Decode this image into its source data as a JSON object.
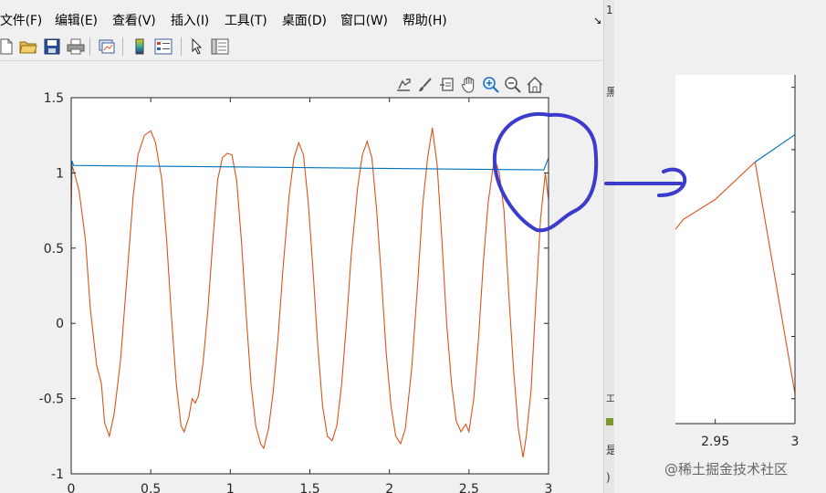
{
  "menu": {
    "items": [
      "文件(F)",
      "编辑(E)",
      "查看(V)",
      "插入(I)",
      "工具(T)",
      "桌面(D)",
      "窗口(W)",
      "帮助(H)"
    ],
    "corner_glyph": "↘"
  },
  "toolbar": {
    "icons": [
      "new-file-icon",
      "open-folder-icon",
      "save-icon",
      "print-icon",
      "link-plot-icon",
      "colorbar-icon",
      "legend-icon",
      "edit-plot-arrow-icon",
      "property-inspector-icon"
    ]
  },
  "axes_toolbar": {
    "icons": [
      "export-icon",
      "brush-icon",
      "datatip-icon",
      "pan-hand-icon",
      "zoom-in-icon",
      "zoom-out-icon",
      "home-icon"
    ]
  },
  "colors": {
    "series_orange": "#d95319",
    "series_blue": "#0072bd",
    "annotation_blue": "#3b3bcc",
    "axes_text": "#262626"
  },
  "chart_data": [
    {
      "type": "line",
      "title": "",
      "xlabel": "",
      "ylabel": "",
      "xlim": [
        0,
        3
      ],
      "ylim": [
        -1,
        1.5
      ],
      "x_ticks": [
        "0",
        "0.5",
        "1",
        "1.5",
        "2",
        "2.5",
        "3"
      ],
      "y_ticks": [
        "-1",
        "-0.5",
        "0",
        "0.5",
        "1",
        "1.5"
      ],
      "grid": false,
      "series": [
        {
          "color": "orange",
          "points": [
            [
              0.0,
              0.74
            ],
            [
              0.005,
              1.05
            ],
            [
              0.02,
              1.0
            ],
            [
              0.05,
              0.88
            ],
            [
              0.09,
              0.55
            ],
            [
              0.12,
              0.1
            ],
            [
              0.16,
              -0.28
            ],
            [
              0.19,
              -0.4
            ],
            [
              0.21,
              -0.66
            ],
            [
              0.24,
              -0.75
            ],
            [
              0.27,
              -0.6
            ],
            [
              0.31,
              -0.25
            ],
            [
              0.35,
              0.3
            ],
            [
              0.39,
              0.85
            ],
            [
              0.42,
              1.12
            ],
            [
              0.46,
              1.25
            ],
            [
              0.5,
              1.28
            ],
            [
              0.53,
              1.2
            ],
            [
              0.57,
              0.95
            ],
            [
              0.6,
              0.55
            ],
            [
              0.63,
              0.05
            ],
            [
              0.66,
              -0.4
            ],
            [
              0.69,
              -0.68
            ],
            [
              0.71,
              -0.72
            ],
            [
              0.74,
              -0.62
            ],
            [
              0.76,
              -0.5
            ],
            [
              0.78,
              -0.53
            ],
            [
              0.8,
              -0.48
            ],
            [
              0.83,
              -0.25
            ],
            [
              0.86,
              0.1
            ],
            [
              0.89,
              0.55
            ],
            [
              0.92,
              0.95
            ],
            [
              0.95,
              1.1
            ],
            [
              0.98,
              1.13
            ],
            [
              1.01,
              1.12
            ],
            [
              1.04,
              0.95
            ],
            [
              1.07,
              0.55
            ],
            [
              1.1,
              0.05
            ],
            [
              1.13,
              -0.4
            ],
            [
              1.16,
              -0.68
            ],
            [
              1.19,
              -0.8
            ],
            [
              1.21,
              -0.83
            ],
            [
              1.24,
              -0.7
            ],
            [
              1.27,
              -0.45
            ],
            [
              1.3,
              -0.1
            ],
            [
              1.33,
              0.35
            ],
            [
              1.37,
              0.85
            ],
            [
              1.4,
              1.1
            ],
            [
              1.43,
              1.2
            ],
            [
              1.46,
              1.12
            ],
            [
              1.49,
              0.8
            ],
            [
              1.52,
              0.35
            ],
            [
              1.55,
              -0.15
            ],
            [
              1.58,
              -0.55
            ],
            [
              1.61,
              -0.75
            ],
            [
              1.64,
              -0.78
            ],
            [
              1.67,
              -0.68
            ],
            [
              1.7,
              -0.4
            ],
            [
              1.73,
              0.0
            ],
            [
              1.76,
              0.45
            ],
            [
              1.8,
              0.9
            ],
            [
              1.83,
              1.12
            ],
            [
              1.86,
              1.21
            ],
            [
              1.89,
              1.1
            ],
            [
              1.92,
              0.75
            ],
            [
              1.95,
              0.3
            ],
            [
              1.98,
              -0.2
            ],
            [
              2.01,
              -0.55
            ],
            [
              2.04,
              -0.75
            ],
            [
              2.07,
              -0.8
            ],
            [
              2.1,
              -0.7
            ],
            [
              2.14,
              -0.3
            ],
            [
              2.18,
              0.3
            ],
            [
              2.21,
              0.8
            ],
            [
              2.24,
              1.1
            ],
            [
              2.27,
              1.3
            ],
            [
              2.3,
              1.05
            ],
            [
              2.33,
              0.55
            ],
            [
              2.36,
              0.0
            ],
            [
              2.39,
              -0.4
            ],
            [
              2.42,
              -0.65
            ],
            [
              2.45,
              -0.72
            ],
            [
              2.48,
              -0.67
            ],
            [
              2.5,
              -0.72
            ],
            [
              2.53,
              -0.5
            ],
            [
              2.56,
              -0.1
            ],
            [
              2.59,
              0.4
            ],
            [
              2.62,
              0.8
            ],
            [
              2.64,
              0.95
            ],
            [
              2.66,
              1.1
            ],
            [
              2.69,
              1.0
            ],
            [
              2.72,
              0.75
            ],
            [
              2.75,
              0.2
            ],
            [
              2.78,
              -0.3
            ],
            [
              2.81,
              -0.7
            ],
            [
              2.84,
              -0.89
            ],
            [
              2.86,
              -0.75
            ],
            [
              2.89,
              -0.45
            ],
            [
              2.92,
              0.15
            ],
            [
              2.95,
              0.7
            ],
            [
              2.98,
              1.0
            ],
            [
              3.0,
              0.82
            ]
          ]
        },
        {
          "color": "blue",
          "points": [
            [
              0.0,
              0.9
            ],
            [
              0.005,
              1.08
            ],
            [
              0.015,
              1.05
            ],
            [
              2.97,
              1.02
            ],
            [
              3.0,
              1.1
            ]
          ]
        }
      ]
    },
    {
      "type": "line",
      "title": "",
      "xlabel": "",
      "ylabel": "",
      "xlim": [
        2.925,
        3
      ],
      "x_ticks": [
        "2.95",
        "3"
      ],
      "y_ticks": [],
      "grid": false,
      "series": [
        {
          "color": "orange",
          "points": [
            [
              2.925,
              0.68
            ],
            [
              2.93,
              0.72
            ],
            [
              2.95,
              0.8
            ],
            [
              2.975,
              0.95
            ],
            [
              3.0,
              0.02
            ]
          ]
        },
        {
          "color": "blue",
          "points": [
            [
              2.975,
              0.95
            ],
            [
              3.0,
              1.06
            ]
          ]
        }
      ]
    }
  ],
  "watermark": "@稀土掘金技术社区",
  "right_strip": {
    "chars": [
      "1",
      "黑",
      "工",
      "是",
      ")"
    ]
  }
}
